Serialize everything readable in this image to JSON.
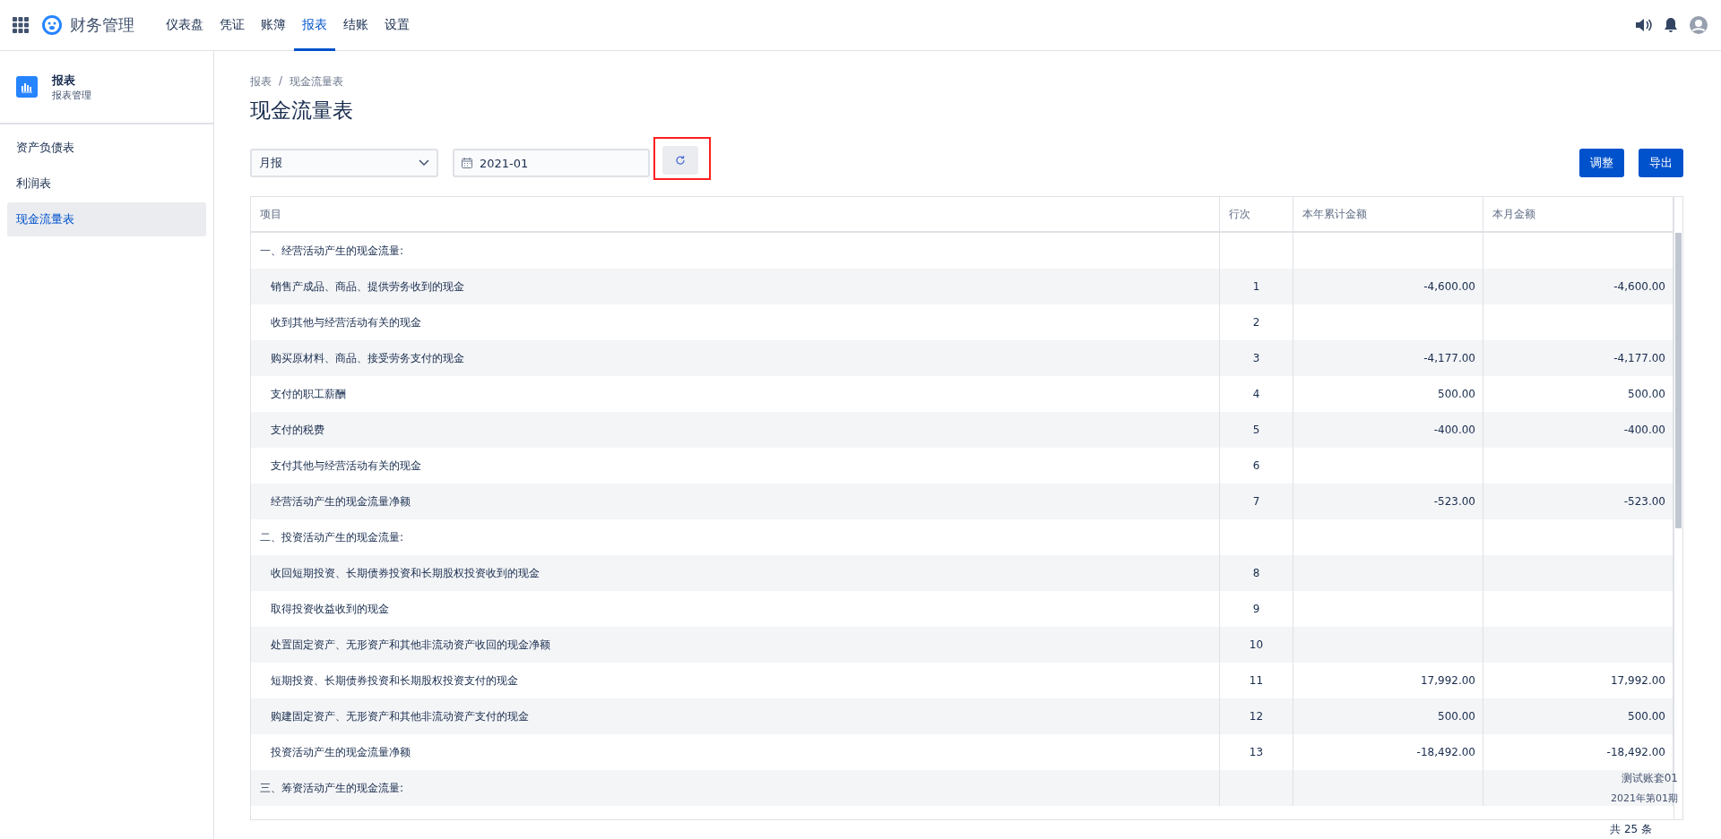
{
  "app": {
    "title": "财务管理"
  },
  "nav": [
    {
      "label": "仪表盘",
      "selected": false
    },
    {
      "label": "凭证",
      "selected": false
    },
    {
      "label": "账簿",
      "selected": false
    },
    {
      "label": "报表",
      "selected": true
    },
    {
      "label": "结账",
      "selected": false
    },
    {
      "label": "设置",
      "selected": false
    }
  ],
  "sidebar": {
    "title": "报表",
    "subtitle": "报表管理",
    "items": [
      {
        "label": "资产负债表",
        "selected": false
      },
      {
        "label": "利润表",
        "selected": false
      },
      {
        "label": "现金流量表",
        "selected": true
      }
    ]
  },
  "breadcrumb": {
    "items": [
      "报表",
      "现金流量表"
    ],
    "separator": "/"
  },
  "page_title": "现金流量表",
  "toolbar": {
    "period_select": "月报",
    "date": "2021-01",
    "refresh_highlighted": true,
    "buttons": [
      "调整",
      "导出"
    ]
  },
  "table": {
    "columns": [
      "项目",
      "行次",
      "本年累计金额",
      "本月金额"
    ],
    "rows": [
      {
        "kind": "section",
        "item": "一、经营活动产生的现金流量:",
        "line": "",
        "ytd": "",
        "month": ""
      },
      {
        "kind": "item",
        "item": "销售产成品、商品、提供劳务收到的现金",
        "line": "1",
        "ytd": "-4,600.00",
        "month": "-4,600.00"
      },
      {
        "kind": "item",
        "item": "收到其他与经营活动有关的现金",
        "line": "2",
        "ytd": "",
        "month": ""
      },
      {
        "kind": "item",
        "item": "购买原材料、商品、接受劳务支付的现金",
        "line": "3",
        "ytd": "-4,177.00",
        "month": "-4,177.00"
      },
      {
        "kind": "item",
        "item": "支付的职工薪酬",
        "line": "4",
        "ytd": "500.00",
        "month": "500.00"
      },
      {
        "kind": "item",
        "item": "支付的税费",
        "line": "5",
        "ytd": "-400.00",
        "month": "-400.00"
      },
      {
        "kind": "item",
        "item": "支付其他与经营活动有关的现金",
        "line": "6",
        "ytd": "",
        "month": ""
      },
      {
        "kind": "item",
        "item": "经营活动产生的现金流量净额",
        "line": "7",
        "ytd": "-523.00",
        "month": "-523.00"
      },
      {
        "kind": "section",
        "item": "二、投资活动产生的现金流量:",
        "line": "",
        "ytd": "",
        "month": ""
      },
      {
        "kind": "item",
        "item": "收回短期投资、长期债券投资和长期股权投资收到的现金",
        "line": "8",
        "ytd": "",
        "month": ""
      },
      {
        "kind": "item",
        "item": "取得投资收益收到的现金",
        "line": "9",
        "ytd": "",
        "month": ""
      },
      {
        "kind": "item",
        "item": "处置固定资产、无形资产和其他非流动资产收回的现金净额",
        "line": "10",
        "ytd": "",
        "month": ""
      },
      {
        "kind": "item",
        "item": "短期投资、长期债券投资和长期股权投资支付的现金",
        "line": "11",
        "ytd": "17,992.00",
        "month": "17,992.00"
      },
      {
        "kind": "item",
        "item": "购建固定资产、无形资产和其他非流动资产支付的现金",
        "line": "12",
        "ytd": "500.00",
        "month": "500.00"
      },
      {
        "kind": "item",
        "item": "投资活动产生的现金流量净额",
        "line": "13",
        "ytd": "-18,492.00",
        "month": "-18,492.00"
      },
      {
        "kind": "section",
        "item": "三、筹资活动产生的现金流量:",
        "line": "",
        "ytd": "",
        "month": ""
      }
    ]
  },
  "account_overlay": {
    "name": "测试账套01",
    "period": "2021年第01期"
  },
  "total": "共 25 条"
}
